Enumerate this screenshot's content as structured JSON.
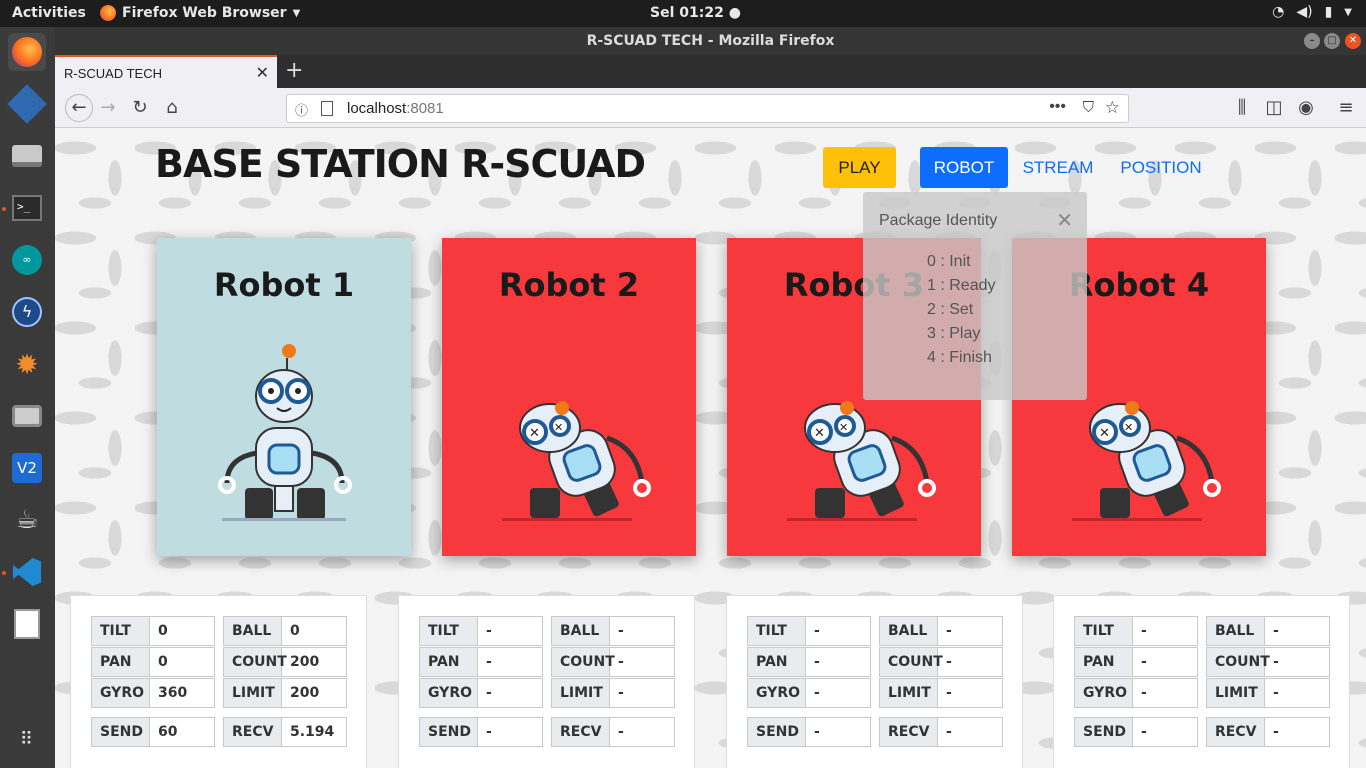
{
  "topbar": {
    "activities": "Activities",
    "app": "Firefox Web Browser",
    "clock": "Sel 01:22"
  },
  "window": {
    "title": "R-SCUAD TECH - Mozilla Firefox"
  },
  "tab": {
    "title": "R-SCUAD TECH"
  },
  "url": {
    "host": "localhost",
    "port": ":8081"
  },
  "page": {
    "brand": "BASE STATION R-SCUAD",
    "nav": {
      "play": "PLAY",
      "robot": "ROBOT",
      "stream": "STREAM",
      "position": "POSITION"
    },
    "robots": [
      "Robot 1",
      "Robot 2",
      "Robot 3",
      "Robot 4"
    ],
    "popover": {
      "title": "Package Identity",
      "items": [
        "0 : Init",
        "1 : Ready",
        "2 : Set",
        "3 : Play",
        "4 : Finish"
      ]
    },
    "labels": {
      "tilt": "TILT",
      "pan": "PAN",
      "gyro": "GYRO",
      "ball": "BALL",
      "count": "COUNT",
      "limit": "LIMIT",
      "send": "SEND",
      "recv": "RECV"
    },
    "stats": [
      {
        "tilt": "0",
        "pan": "0",
        "gyro": "360",
        "ball": "0",
        "count": "200",
        "limit": "200",
        "send": "60",
        "recv": "5.194"
      },
      {
        "tilt": "-",
        "pan": "-",
        "gyro": "-",
        "ball": "-",
        "count": "-",
        "limit": "-",
        "send": "-",
        "recv": "-"
      },
      {
        "tilt": "-",
        "pan": "-",
        "gyro": "-",
        "ball": "-",
        "count": "-",
        "limit": "-",
        "send": "-",
        "recv": "-"
      },
      {
        "tilt": "-",
        "pan": "-",
        "gyro": "-",
        "ball": "-",
        "count": "-",
        "limit": "-",
        "send": "-",
        "recv": "-"
      }
    ]
  }
}
